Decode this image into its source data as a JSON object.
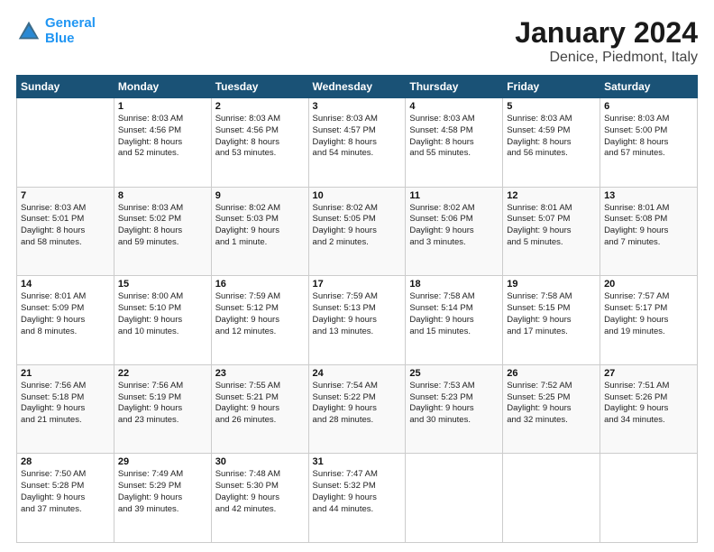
{
  "header": {
    "logo_line1": "General",
    "logo_line2": "Blue",
    "title": "January 2024",
    "subtitle": "Denice, Piedmont, Italy"
  },
  "days_of_week": [
    "Sunday",
    "Monday",
    "Tuesday",
    "Wednesday",
    "Thursday",
    "Friday",
    "Saturday"
  ],
  "weeks": [
    [
      {
        "day": "",
        "info": ""
      },
      {
        "day": "1",
        "info": "Sunrise: 8:03 AM\nSunset: 4:56 PM\nDaylight: 8 hours\nand 52 minutes."
      },
      {
        "day": "2",
        "info": "Sunrise: 8:03 AM\nSunset: 4:56 PM\nDaylight: 8 hours\nand 53 minutes."
      },
      {
        "day": "3",
        "info": "Sunrise: 8:03 AM\nSunset: 4:57 PM\nDaylight: 8 hours\nand 54 minutes."
      },
      {
        "day": "4",
        "info": "Sunrise: 8:03 AM\nSunset: 4:58 PM\nDaylight: 8 hours\nand 55 minutes."
      },
      {
        "day": "5",
        "info": "Sunrise: 8:03 AM\nSunset: 4:59 PM\nDaylight: 8 hours\nand 56 minutes."
      },
      {
        "day": "6",
        "info": "Sunrise: 8:03 AM\nSunset: 5:00 PM\nDaylight: 8 hours\nand 57 minutes."
      }
    ],
    [
      {
        "day": "7",
        "info": "Sunrise: 8:03 AM\nSunset: 5:01 PM\nDaylight: 8 hours\nand 58 minutes."
      },
      {
        "day": "8",
        "info": "Sunrise: 8:03 AM\nSunset: 5:02 PM\nDaylight: 8 hours\nand 59 minutes."
      },
      {
        "day": "9",
        "info": "Sunrise: 8:02 AM\nSunset: 5:03 PM\nDaylight: 9 hours\nand 1 minute."
      },
      {
        "day": "10",
        "info": "Sunrise: 8:02 AM\nSunset: 5:05 PM\nDaylight: 9 hours\nand 2 minutes."
      },
      {
        "day": "11",
        "info": "Sunrise: 8:02 AM\nSunset: 5:06 PM\nDaylight: 9 hours\nand 3 minutes."
      },
      {
        "day": "12",
        "info": "Sunrise: 8:01 AM\nSunset: 5:07 PM\nDaylight: 9 hours\nand 5 minutes."
      },
      {
        "day": "13",
        "info": "Sunrise: 8:01 AM\nSunset: 5:08 PM\nDaylight: 9 hours\nand 7 minutes."
      }
    ],
    [
      {
        "day": "14",
        "info": "Sunrise: 8:01 AM\nSunset: 5:09 PM\nDaylight: 9 hours\nand 8 minutes."
      },
      {
        "day": "15",
        "info": "Sunrise: 8:00 AM\nSunset: 5:10 PM\nDaylight: 9 hours\nand 10 minutes."
      },
      {
        "day": "16",
        "info": "Sunrise: 7:59 AM\nSunset: 5:12 PM\nDaylight: 9 hours\nand 12 minutes."
      },
      {
        "day": "17",
        "info": "Sunrise: 7:59 AM\nSunset: 5:13 PM\nDaylight: 9 hours\nand 13 minutes."
      },
      {
        "day": "18",
        "info": "Sunrise: 7:58 AM\nSunset: 5:14 PM\nDaylight: 9 hours\nand 15 minutes."
      },
      {
        "day": "19",
        "info": "Sunrise: 7:58 AM\nSunset: 5:15 PM\nDaylight: 9 hours\nand 17 minutes."
      },
      {
        "day": "20",
        "info": "Sunrise: 7:57 AM\nSunset: 5:17 PM\nDaylight: 9 hours\nand 19 minutes."
      }
    ],
    [
      {
        "day": "21",
        "info": "Sunrise: 7:56 AM\nSunset: 5:18 PM\nDaylight: 9 hours\nand 21 minutes."
      },
      {
        "day": "22",
        "info": "Sunrise: 7:56 AM\nSunset: 5:19 PM\nDaylight: 9 hours\nand 23 minutes."
      },
      {
        "day": "23",
        "info": "Sunrise: 7:55 AM\nSunset: 5:21 PM\nDaylight: 9 hours\nand 26 minutes."
      },
      {
        "day": "24",
        "info": "Sunrise: 7:54 AM\nSunset: 5:22 PM\nDaylight: 9 hours\nand 28 minutes."
      },
      {
        "day": "25",
        "info": "Sunrise: 7:53 AM\nSunset: 5:23 PM\nDaylight: 9 hours\nand 30 minutes."
      },
      {
        "day": "26",
        "info": "Sunrise: 7:52 AM\nSunset: 5:25 PM\nDaylight: 9 hours\nand 32 minutes."
      },
      {
        "day": "27",
        "info": "Sunrise: 7:51 AM\nSunset: 5:26 PM\nDaylight: 9 hours\nand 34 minutes."
      }
    ],
    [
      {
        "day": "28",
        "info": "Sunrise: 7:50 AM\nSunset: 5:28 PM\nDaylight: 9 hours\nand 37 minutes."
      },
      {
        "day": "29",
        "info": "Sunrise: 7:49 AM\nSunset: 5:29 PM\nDaylight: 9 hours\nand 39 minutes."
      },
      {
        "day": "30",
        "info": "Sunrise: 7:48 AM\nSunset: 5:30 PM\nDaylight: 9 hours\nand 42 minutes."
      },
      {
        "day": "31",
        "info": "Sunrise: 7:47 AM\nSunset: 5:32 PM\nDaylight: 9 hours\nand 44 minutes."
      },
      {
        "day": "",
        "info": ""
      },
      {
        "day": "",
        "info": ""
      },
      {
        "day": "",
        "info": ""
      }
    ]
  ]
}
